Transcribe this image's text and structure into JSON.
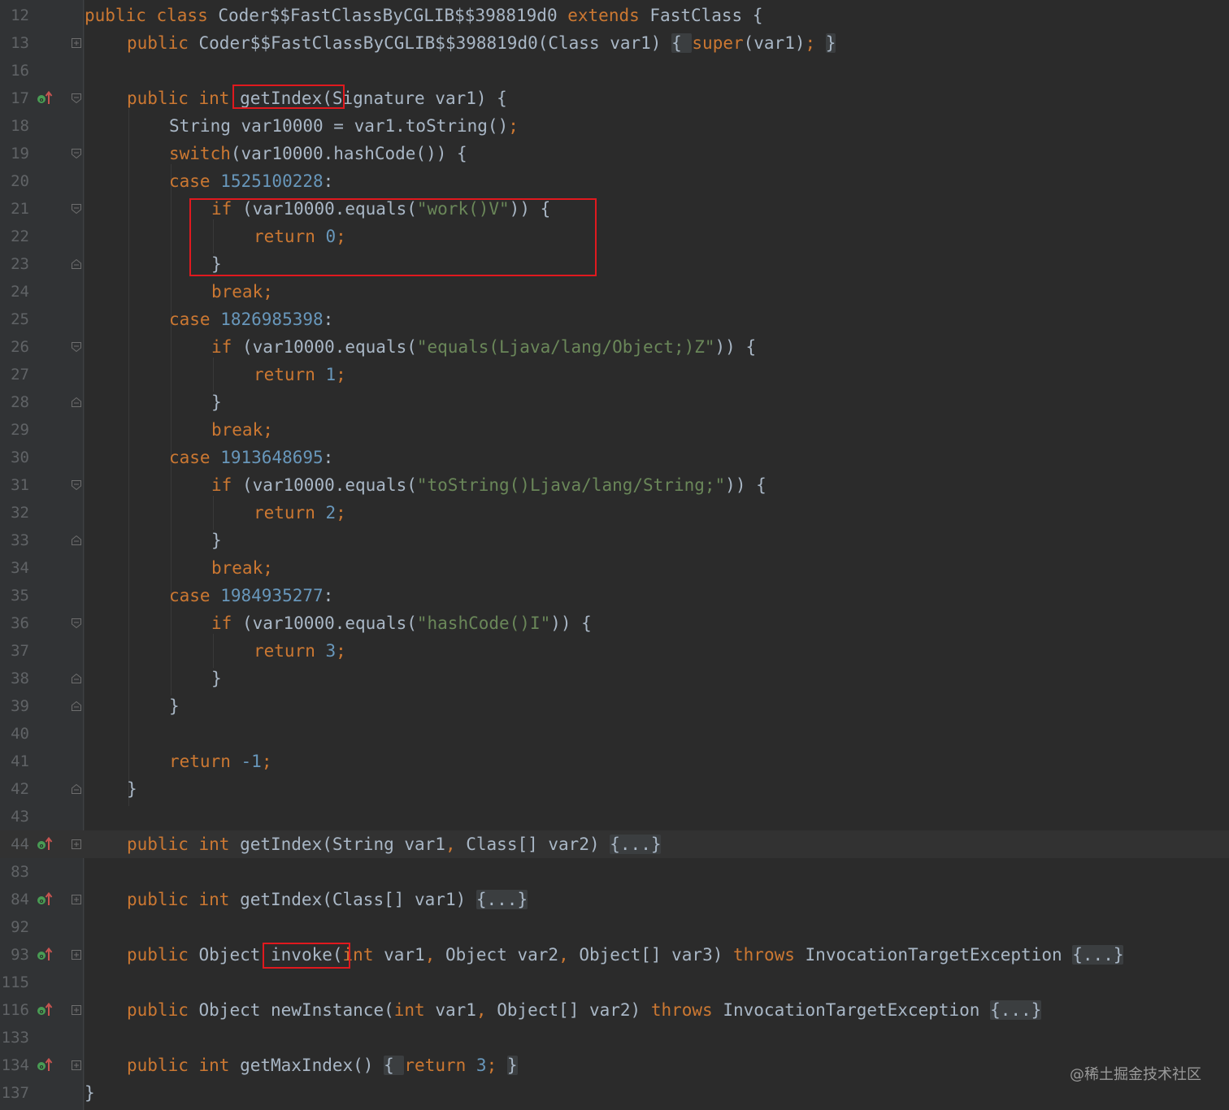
{
  "colors": {
    "background": "#2b2b2b",
    "gutter": "#313335",
    "keyword": "#cc7832",
    "number": "#6897bb",
    "string": "#6a8759",
    "identifier": "#a9b7c6",
    "line_number": "#606366",
    "highlight_box": "#e0191e",
    "override_marker": "#499c54"
  },
  "lines": [
    {
      "n": "12",
      "indent": 0,
      "tokens": [
        [
          "kw",
          "public class "
        ],
        [
          "id",
          "Coder$$FastClassByCGLIB$$398819d0 "
        ],
        [
          "kw",
          "extends "
        ],
        [
          "id",
          "FastClass {"
        ]
      ]
    },
    {
      "n": "13",
      "indent": 1,
      "fold": "plus",
      "tokens": [
        [
          "kw",
          "public "
        ],
        [
          "id",
          "Coder$$FastClassByCGLIB$$398819d0(Class var1) "
        ],
        [
          "fb",
          "{ "
        ],
        [
          "kw",
          "super"
        ],
        [
          "id",
          "(var1)"
        ],
        [
          "kw",
          "; "
        ],
        [
          "fb",
          "}"
        ]
      ]
    },
    {
      "n": "16",
      "indent": 0,
      "tokens": []
    },
    {
      "n": "17",
      "indent": 1,
      "marker": "override",
      "fold": "open",
      "tokens": [
        [
          "kw",
          "public int "
        ],
        [
          "id",
          "getIndex(Signature var1) {"
        ]
      ]
    },
    {
      "n": "18",
      "indent": 2,
      "tokens": [
        [
          "id",
          "String var10000 = var1.toString()"
        ],
        [
          "kw",
          ";"
        ]
      ]
    },
    {
      "n": "19",
      "indent": 2,
      "fold": "open",
      "tokens": [
        [
          "kw",
          "switch"
        ],
        [
          "id",
          "(var10000.hashCode()) {"
        ]
      ]
    },
    {
      "n": "20",
      "indent": 2,
      "tokens": [
        [
          "kw",
          "case "
        ],
        [
          "num",
          "1525100228"
        ],
        [
          "id",
          ":"
        ]
      ]
    },
    {
      "n": "21",
      "indent": 3,
      "fold": "open",
      "tokens": [
        [
          "kw",
          "if "
        ],
        [
          "id",
          "(var10000.equals("
        ],
        [
          "str",
          "\"work()V\""
        ],
        [
          "id",
          ")) {"
        ]
      ]
    },
    {
      "n": "22",
      "indent": 4,
      "tokens": [
        [
          "kw",
          "return "
        ],
        [
          "num",
          "0"
        ],
        [
          "kw",
          ";"
        ]
      ]
    },
    {
      "n": "23",
      "indent": 3,
      "fold": "close",
      "tokens": [
        [
          "id",
          "}"
        ]
      ]
    },
    {
      "n": "24",
      "indent": 3,
      "tokens": [
        [
          "kw",
          "break;"
        ]
      ]
    },
    {
      "n": "25",
      "indent": 2,
      "tokens": [
        [
          "kw",
          "case "
        ],
        [
          "num",
          "1826985398"
        ],
        [
          "id",
          ":"
        ]
      ]
    },
    {
      "n": "26",
      "indent": 3,
      "fold": "open",
      "tokens": [
        [
          "kw",
          "if "
        ],
        [
          "id",
          "(var10000.equals("
        ],
        [
          "str",
          "\"equals(Ljava/lang/Object;)Z\""
        ],
        [
          "id",
          ")) {"
        ]
      ]
    },
    {
      "n": "27",
      "indent": 4,
      "tokens": [
        [
          "kw",
          "return "
        ],
        [
          "num",
          "1"
        ],
        [
          "kw",
          ";"
        ]
      ]
    },
    {
      "n": "28",
      "indent": 3,
      "fold": "close",
      "tokens": [
        [
          "id",
          "}"
        ]
      ]
    },
    {
      "n": "29",
      "indent": 3,
      "tokens": [
        [
          "kw",
          "break;"
        ]
      ]
    },
    {
      "n": "30",
      "indent": 2,
      "tokens": [
        [
          "kw",
          "case "
        ],
        [
          "num",
          "1913648695"
        ],
        [
          "id",
          ":"
        ]
      ]
    },
    {
      "n": "31",
      "indent": 3,
      "fold": "open",
      "tokens": [
        [
          "kw",
          "if "
        ],
        [
          "id",
          "(var10000.equals("
        ],
        [
          "str",
          "\"toString()Ljava/lang/String;\""
        ],
        [
          "id",
          ")) {"
        ]
      ]
    },
    {
      "n": "32",
      "indent": 4,
      "tokens": [
        [
          "kw",
          "return "
        ],
        [
          "num",
          "2"
        ],
        [
          "kw",
          ";"
        ]
      ]
    },
    {
      "n": "33",
      "indent": 3,
      "fold": "close",
      "tokens": [
        [
          "id",
          "}"
        ]
      ]
    },
    {
      "n": "34",
      "indent": 3,
      "tokens": [
        [
          "kw",
          "break;"
        ]
      ]
    },
    {
      "n": "35",
      "indent": 2,
      "tokens": [
        [
          "kw",
          "case "
        ],
        [
          "num",
          "1984935277"
        ],
        [
          "id",
          ":"
        ]
      ]
    },
    {
      "n": "36",
      "indent": 3,
      "fold": "open",
      "tokens": [
        [
          "kw",
          "if "
        ],
        [
          "id",
          "(var10000.equals("
        ],
        [
          "str",
          "\"hashCode()I\""
        ],
        [
          "id",
          ")) {"
        ]
      ]
    },
    {
      "n": "37",
      "indent": 4,
      "tokens": [
        [
          "kw",
          "return "
        ],
        [
          "num",
          "3"
        ],
        [
          "kw",
          ";"
        ]
      ]
    },
    {
      "n": "38",
      "indent": 3,
      "fold": "close",
      "tokens": [
        [
          "id",
          "}"
        ]
      ]
    },
    {
      "n": "39",
      "indent": 2,
      "fold": "close",
      "tokens": [
        [
          "id",
          "}"
        ]
      ]
    },
    {
      "n": "40",
      "indent": 0,
      "tokens": []
    },
    {
      "n": "41",
      "indent": 2,
      "tokens": [
        [
          "kw",
          "return "
        ],
        [
          "num",
          "-1"
        ],
        [
          "kw",
          ";"
        ]
      ]
    },
    {
      "n": "42",
      "indent": 1,
      "fold": "close",
      "tokens": [
        [
          "id",
          "}"
        ]
      ]
    },
    {
      "n": "43",
      "indent": 0,
      "tokens": []
    },
    {
      "n": "44",
      "indent": 1,
      "marker": "override",
      "fold": "plus",
      "highlight": true,
      "tokens": [
        [
          "kw",
          "public int "
        ],
        [
          "id",
          "getIndex(String var1"
        ],
        [
          "kw",
          ", "
        ],
        [
          "id",
          "Class[] var2) "
        ],
        [
          "fb",
          "{...}"
        ]
      ]
    },
    {
      "n": "83",
      "indent": 0,
      "tokens": []
    },
    {
      "n": "84",
      "indent": 1,
      "marker": "override",
      "fold": "plus",
      "tokens": [
        [
          "kw",
          "public int "
        ],
        [
          "id",
          "getIndex(Class[] var1) "
        ],
        [
          "fb",
          "{...}"
        ]
      ]
    },
    {
      "n": "92",
      "indent": 0,
      "tokens": []
    },
    {
      "n": "93",
      "indent": 1,
      "marker": "override",
      "fold": "plus",
      "tokens": [
        [
          "kw",
          "public "
        ],
        [
          "id",
          "Object invoke("
        ],
        [
          "kw",
          "int "
        ],
        [
          "id",
          "var1"
        ],
        [
          "kw",
          ", "
        ],
        [
          "id",
          "Object var2"
        ],
        [
          "kw",
          ", "
        ],
        [
          "id",
          "Object[] var3) "
        ],
        [
          "kw",
          "throws "
        ],
        [
          "id",
          "InvocationTargetException "
        ],
        [
          "fb",
          "{...}"
        ]
      ]
    },
    {
      "n": "115",
      "indent": 0,
      "tokens": []
    },
    {
      "n": "116",
      "indent": 1,
      "marker": "override",
      "fold": "plus",
      "tokens": [
        [
          "kw",
          "public "
        ],
        [
          "id",
          "Object newInstance("
        ],
        [
          "kw",
          "int "
        ],
        [
          "id",
          "var1"
        ],
        [
          "kw",
          ", "
        ],
        [
          "id",
          "Object[] var2) "
        ],
        [
          "kw",
          "throws "
        ],
        [
          "id",
          "InvocationTargetException "
        ],
        [
          "fb",
          "{...}"
        ]
      ]
    },
    {
      "n": "133",
      "indent": 0,
      "tokens": []
    },
    {
      "n": "134",
      "indent": 1,
      "marker": "override",
      "fold": "plus",
      "tokens": [
        [
          "kw",
          "public int "
        ],
        [
          "id",
          "getMaxIndex() "
        ],
        [
          "fb",
          "{ "
        ],
        [
          "kw",
          "return "
        ],
        [
          "num",
          "3"
        ],
        [
          "kw",
          "; "
        ],
        [
          "fb",
          "}"
        ]
      ]
    },
    {
      "n": "137",
      "indent": 0,
      "tokens": [
        [
          "id",
          "}"
        ]
      ]
    }
  ],
  "watermark": "@稀土掘金技术社区"
}
